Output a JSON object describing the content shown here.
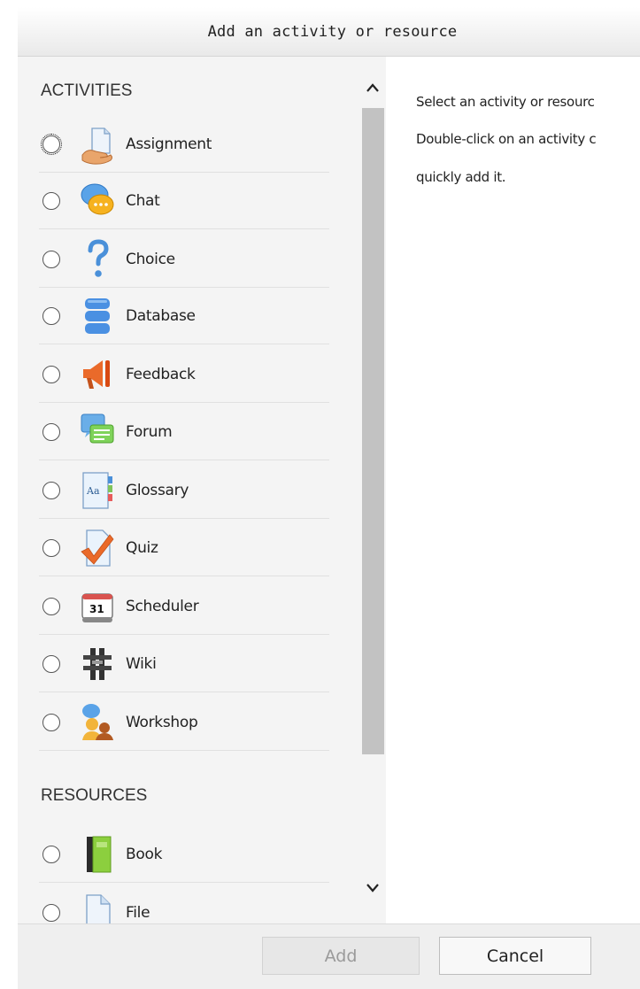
{
  "dialog": {
    "title": "Add an activity or resource"
  },
  "activities": {
    "heading": "ACTIVITIES",
    "items": [
      {
        "label": "Assignment",
        "icon": "assignment-icon"
      },
      {
        "label": "Chat",
        "icon": "chat-icon"
      },
      {
        "label": "Choice",
        "icon": "choice-icon"
      },
      {
        "label": "Database",
        "icon": "database-icon"
      },
      {
        "label": "Feedback",
        "icon": "feedback-icon"
      },
      {
        "label": "Forum",
        "icon": "forum-icon"
      },
      {
        "label": "Glossary",
        "icon": "glossary-icon"
      },
      {
        "label": "Quiz",
        "icon": "quiz-icon"
      },
      {
        "label": "Scheduler",
        "icon": "scheduler-icon",
        "icon_text": "31"
      },
      {
        "label": "Wiki",
        "icon": "wiki-icon"
      },
      {
        "label": "Workshop",
        "icon": "workshop-icon"
      }
    ]
  },
  "resources": {
    "heading": "RESOURCES",
    "items": [
      {
        "label": "Book",
        "icon": "book-icon"
      },
      {
        "label": "File",
        "icon": "file-icon"
      }
    ]
  },
  "help": {
    "line1": "Select an activity or resourc",
    "line2": "Double-click on an activity c",
    "line3": "quickly add it."
  },
  "footer": {
    "add_label": "Add",
    "cancel_label": "Cancel"
  },
  "colors": {
    "add_disabled_text": "#9a9a9a",
    "scroll_thumb": "#c2c2c2",
    "pane_bg": "#f4f4f4"
  }
}
